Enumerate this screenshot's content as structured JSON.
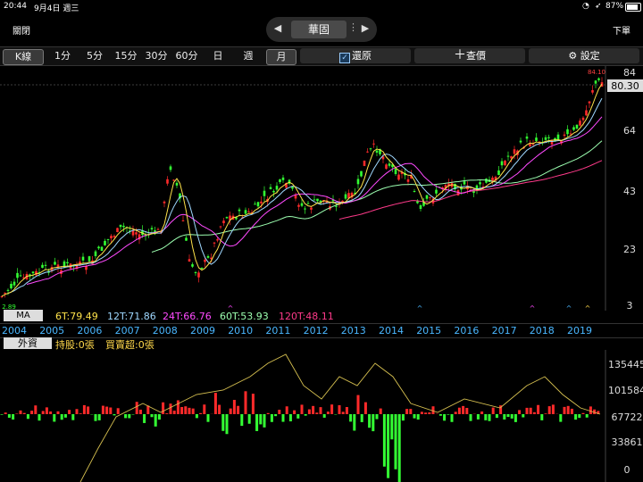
{
  "status": {
    "time": "20:44",
    "date": "9月4日 週三",
    "battery": "87%"
  },
  "topbar": {
    "close": "關閉",
    "stock_name": "華固",
    "order": "下單"
  },
  "toolbar": {
    "kline": "K線",
    "intervals": [
      "1分",
      "5分",
      "15分",
      "30分",
      "60分",
      "日",
      "週",
      "月"
    ],
    "restore": "還原",
    "quote": "查價",
    "settings": "設定"
  },
  "price_axis": {
    "ticks": [
      "84",
      "64",
      "43",
      "23",
      "3"
    ],
    "current": "80.30",
    "max_label": "84.10",
    "min_label": "2.89"
  },
  "ma_row": {
    "label": "MA",
    "values": [
      {
        "text": "6T:79.49",
        "color": "#ffe34a"
      },
      {
        "text": "12T:71.86",
        "color": "#9fd8ff"
      },
      {
        "text": "24T:66.76",
        "color": "#ff4aff"
      },
      {
        "text": "60T:53.93",
        "color": "#9cffb0"
      },
      {
        "text": "120T:48.11",
        "color": "#ff3a8a"
      }
    ]
  },
  "years": [
    "2004",
    "2005",
    "2006",
    "2007",
    "2008",
    "2009",
    "2010",
    "2011",
    "2012",
    "2013",
    "2014",
    "2015",
    "2016",
    "2017",
    "2018",
    "2019"
  ],
  "foreign": {
    "label": "外資",
    "holding": "持股:0張",
    "net": "買賣超:0張",
    "axis": [
      "135445",
      "101584",
      "67722",
      "33861",
      "0"
    ]
  },
  "colors": {
    "up": "#ff2a2a",
    "down": "#33ff33",
    "accent": "#4ab7ff"
  }
}
